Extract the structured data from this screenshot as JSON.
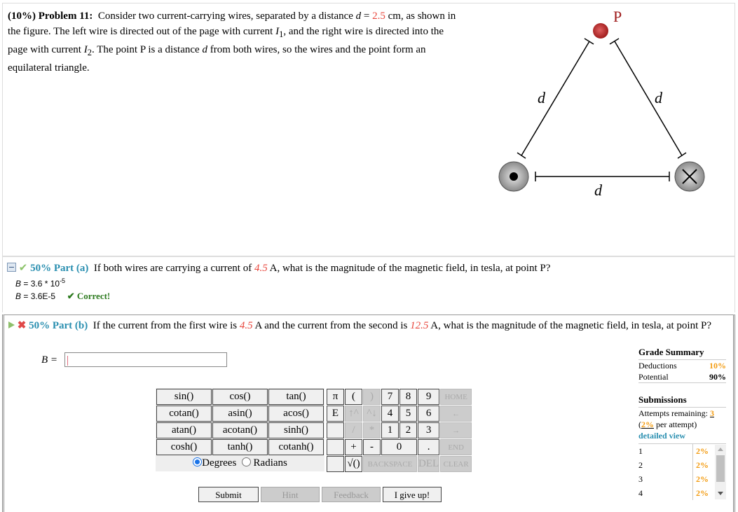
{
  "problem": {
    "weight": "(10%)",
    "number": "Problem 11:",
    "text_1": "Consider two current-carrying wires, separated by a distance ",
    "d_var": "d",
    "eq": " = ",
    "d_value": "2.5",
    "text_2": " cm, as shown in the figure. The left wire is directed out of the page with current ",
    "I1": "I",
    "I1_sub": "1",
    "text_3": ", and the right wire is directed into the page with current ",
    "I2": "I",
    "I2_sub": "2",
    "text_4": ". The point P is a distance ",
    "d_var2": "d",
    "text_5": " from both wires, so the wires and the point form an equilateral triangle."
  },
  "diagram": {
    "point_label": "P",
    "left_side_label": "d",
    "right_side_label": "d",
    "bottom_label": "d",
    "left_wire": "out-of-page",
    "right_wire": "into-page"
  },
  "part_a": {
    "weight": "50%",
    "label": "Part (a)",
    "q1": "If both wires are carrying a current of ",
    "current": "4.5",
    "q2": " A, what is the magnitude of the magnetic field, in tesla, at point P?",
    "ans_var": "B",
    "ans_expr": " = 3.6 * 10",
    "ans_exp": "-5",
    "ans_var2": "B",
    "ans_value": " = 3.6E-5",
    "status": "✔ Correct!"
  },
  "part_b": {
    "weight": "50%",
    "label": "Part (b)",
    "q1": "If the current from the first wire is ",
    "current1": "4.5",
    "q2": " A and the current from the second is ",
    "current2": "12.5",
    "q3": " A, what is the magnitude of the magnetic field, in tesla, at point P?",
    "input_label": "B =",
    "input_value": ""
  },
  "calculator": {
    "functions": [
      [
        "sin()",
        "cos()",
        "tan()"
      ],
      [
        "cotan()",
        "asin()",
        "acos()"
      ],
      [
        "atan()",
        "acotan()",
        "sinh()"
      ],
      [
        "cosh()",
        "tanh()",
        "cotanh()"
      ]
    ],
    "angle_mode": {
      "degrees": "Degrees",
      "radians": "Radians",
      "selected": "Degrees"
    },
    "keys": {
      "pi": "π",
      "open_paren": "(",
      "close_paren": ")",
      "k7": "7",
      "k8": "8",
      "k9": "9",
      "home": "HOME",
      "E": "E",
      "up_caret": "↑^",
      "caret_down": "^↓",
      "k4": "4",
      "k5": "5",
      "k6": "6",
      "left": "←",
      "slash": "/",
      "star": "*",
      "k1": "1",
      "k2": "2",
      "k3": "3",
      "right": "→",
      "plus": "+",
      "minus": "-",
      "k0": "0",
      "dot": ".",
      "end": "END",
      "sqrt": "√()",
      "backspace": "BACKSPACE",
      "del": "DEL",
      "clear": "CLEAR"
    }
  },
  "buttons": {
    "submit": "Submit",
    "hint": "Hint",
    "feedback": "Feedback",
    "give_up": "I give up!"
  },
  "grade_summary": {
    "title": "Grade Summary",
    "deductions_label": "Deductions",
    "deductions_value": "10%",
    "potential_label": "Potential",
    "potential_value": "90%",
    "submissions_title": "Submissions",
    "attempts_label": "Attempts remaining: ",
    "attempts_value": "3",
    "per_attempt_open": "(",
    "per_attempt_value": "2%",
    "per_attempt_text": " per attempt)",
    "detailed_view": "detailed view",
    "submissions": [
      {
        "n": "1",
        "p": "2%"
      },
      {
        "n": "2",
        "p": "2%"
      },
      {
        "n": "3",
        "p": "2%"
      },
      {
        "n": "4",
        "p": "2%"
      }
    ]
  }
}
